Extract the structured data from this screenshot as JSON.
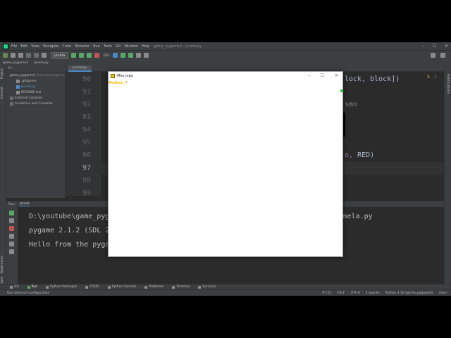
{
  "menubar": {
    "items": [
      "File",
      "Edit",
      "View",
      "Navigate",
      "Code",
      "Refactor",
      "Run",
      "Tools",
      "Git",
      "Window",
      "Help"
    ],
    "window_title": "game_pygame2 - janela.py"
  },
  "navbar": {
    "run_config": "janela",
    "git_label": "Git:"
  },
  "crumbs": [
    "game_pygame2",
    "janela.py"
  ],
  "left_strip": [
    "Project",
    "Commit"
  ],
  "left_strip_bottom": [
    "Bookmarks",
    "Structure"
  ],
  "right_strip": "Notifications",
  "project": {
    "root": "game_pygame2",
    "root_path": "D:\\youtube\\game_py...",
    "files": [
      ".gitignore",
      "janela.py",
      "README.md"
    ],
    "other": [
      "External Libraries",
      "Scratches and Consoles"
    ]
  },
  "editor": {
    "tab": "janela.py",
    "lines": [
      "90",
      "91",
      "92",
      "93",
      "94",
      "95",
      "96",
      "97",
      "98",
      "99"
    ],
    "current_line": "97",
    "frag_top": "lock, block])",
    "frag_mid": "smo",
    "frag_red_a": "o, ",
    "frag_red_b": "RED)",
    "warnings": "5",
    "weak_warnings": "2"
  },
  "run": {
    "head_label": "Run:",
    "config": "janela",
    "console": [
      "D:\\youtube\\game_pygame2\\venv\\Scripts\\python.exe D:/youtube/game_pygame2/janela.py",
      "pygame 2.1.2 (SDL 2.0.18, Python 3.10.0)",
      "Hello from the pygame community. https://www.pygame.org/contribute.html"
    ]
  },
  "bottom_tabs": [
    "Git",
    "Run",
    "Python Packages",
    "TODO",
    "Python Console",
    "Problems",
    "Terminal",
    "Services"
  ],
  "status": {
    "message": "Run selected configuration",
    "position": "97:55",
    "line_sep": "CRLF",
    "encoding": "UTF-8",
    "indent": "4 spaces",
    "interpreter": "Python 3.10 (game_pygame2)",
    "branch": "main"
  },
  "pygame": {
    "title": "Meu jogo",
    "score": "Pontos: 7"
  },
  "colors": {
    "accent": "#4a88c7",
    "score": "#e6b800"
  }
}
